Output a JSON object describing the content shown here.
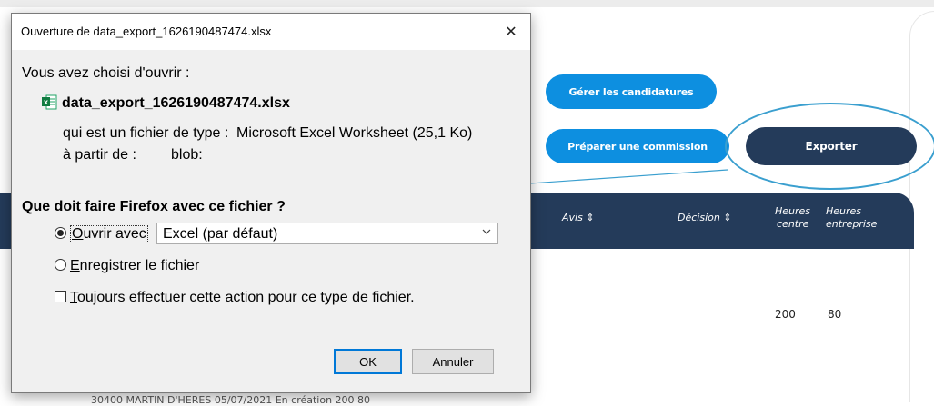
{
  "app": {
    "buttons": {
      "gerer": "Gérer les candidatures",
      "preparer": "Préparer une commission",
      "exporter": "Exporter"
    },
    "table": {
      "headers": {
        "avis": "Avis ⇕",
        "decision": "Décision ⇕",
        "heures_centre_1": "Heures",
        "heures_centre_2": "centre",
        "heures_entreprise_1": "Heures",
        "heures_entreprise_2": "entreprise"
      },
      "row": {
        "heures_centre": "200",
        "heures_entreprise": "80"
      },
      "partial_row": "30400      MARTIN D'HERES      05/07/2021      En création                                              200     80"
    },
    "colors": {
      "primary_blue": "#0d8fe0",
      "dark_navy": "#243b5a",
      "highlight": "#3a9fcf"
    }
  },
  "dialog": {
    "title": "Ouverture de data_export_1626190487474.xlsx",
    "close_glyph": "✕",
    "choisi": "Vous avez choisi d'ouvrir :",
    "filename": "data_export_1626190487474.xlsx",
    "type_label": "qui est un fichier de type :",
    "type_value": "Microsoft Excel Worksheet (25,1 Ko)",
    "from_label": "à partir de :",
    "from_value": "blob:",
    "question": "Que doit faire Firefox avec ce fichier ?",
    "open_with_first": "O",
    "open_with_rest": "uvrir avec",
    "open_with_app": "Excel (par défaut)",
    "save_first": "E",
    "save_rest": "nregistrer le fichier",
    "always_first": "T",
    "always_rest": "oujours effectuer cette action pour ce type de fichier.",
    "ok": "OK",
    "cancel": "Annuler",
    "selected_option": "open"
  },
  "icons": {
    "file": "excel-file-icon",
    "close": "close-icon",
    "chevron": "chevron-down-icon"
  }
}
